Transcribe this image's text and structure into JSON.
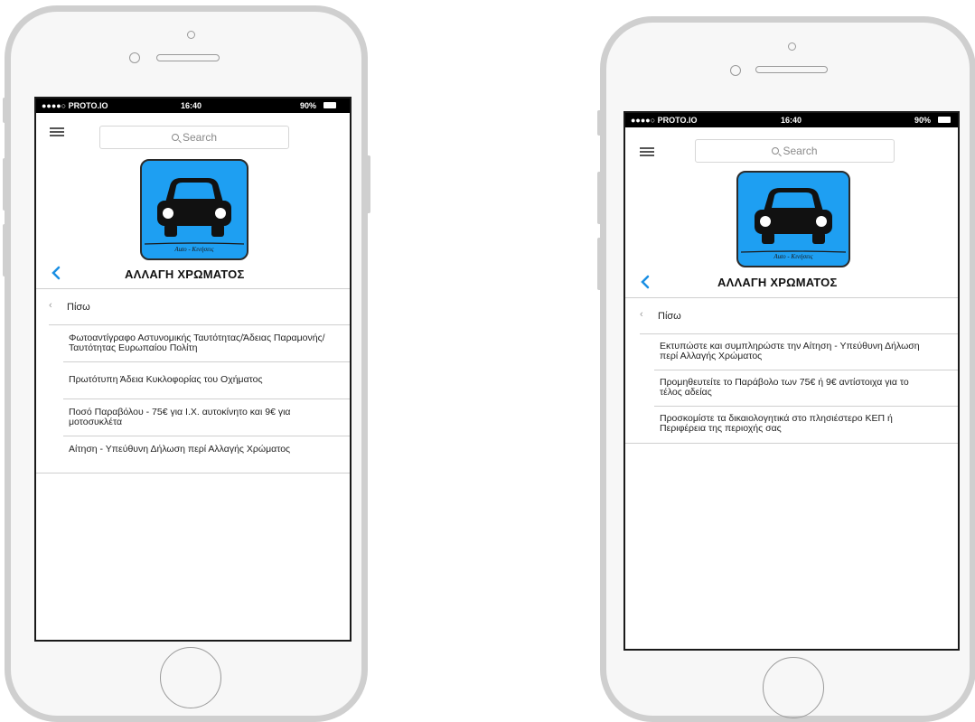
{
  "status_bar": {
    "carrier": "●●●●○ PROTO.IO",
    "time": "16:40",
    "battery": "90%"
  },
  "search": {
    "placeholder": "Search"
  },
  "app_icon": {
    "caption": "Auto - Κινήσεις"
  },
  "screens": [
    {
      "title": "ΑΛΛΑΓΗ ΧΡΩΜΑΤΟΣ",
      "back_label": "Πίσω",
      "items": [
        "Φωτοαντίγραφο Αστυνομικής Ταυτότητας/Άδειας Παραμονής/Ταυτότητας Ευρωπαίου Πολίτη",
        "Πρωτότυπη Άδεια Κυκλοφορίας του Οχήματος",
        "Ποσό Παραβόλου - 75€ για Ι.Χ. αυτοκίνητο και 9€ για μοτοσυκλέτα",
        "Αίτηση - Υπεύθυνη Δήλωση περί Αλλαγής Χρώματος"
      ]
    },
    {
      "title": "ΑΛΛΑΓΗ ΧΡΩΜΑΤΟΣ",
      "back_label": "Πίσω",
      "items": [
        "Εκτυπώστε και συμπληρώστε την Αίτηση - Υπεύθυνη Δήλωση περί Αλλαγής Χρώματος",
        "Προμηθευτείτε το Παράβολο των 75€ ή 9€ αντίστοιχα για το τέλος αδείας",
        "Προσκομίστε τα δικαιολογητικά στο πλησιέστερο ΚΕΠ ή Περιφέρεια της περιοχής σας"
      ]
    }
  ]
}
